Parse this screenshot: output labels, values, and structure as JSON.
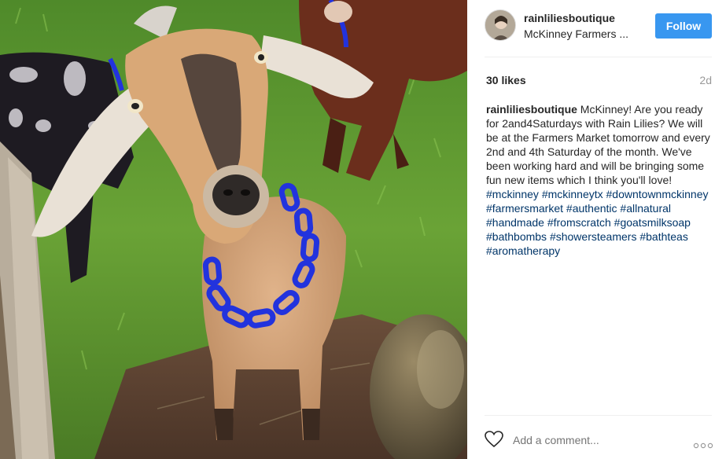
{
  "post": {
    "username": "rainliliesboutique",
    "location": "McKinney Farmers ...",
    "follow_label": "Follow",
    "likes": "30 likes",
    "time": "2d",
    "caption_text": "McKinney! Are you ready for 2and4Saturdays with Rain Lilies? We will be at the Farmers Market tomorrow and every 2nd and 4th Saturday of the month. We've been working hard and will be bringing some fun new items which I think you'll love! ",
    "hashtags": [
      "#mckinney",
      "#mckinneytx",
      "#downtownmckinney",
      "#farmersmarket",
      "#authentic",
      "#allnatural",
      "#handmade",
      "#fromscratch",
      "#goatsmilksoap",
      "#bathbombs",
      "#showersteamers",
      "#bathteas",
      "#aromatherapy"
    ],
    "comment_placeholder": "Add a comment..."
  },
  "icons": {
    "heart": "heart-outline-icon",
    "more": "more-options-icon"
  },
  "colors": {
    "follow_button": "#3897f0",
    "hashtag": "#003569",
    "muted": "#999999",
    "collar": "#2233dd"
  }
}
